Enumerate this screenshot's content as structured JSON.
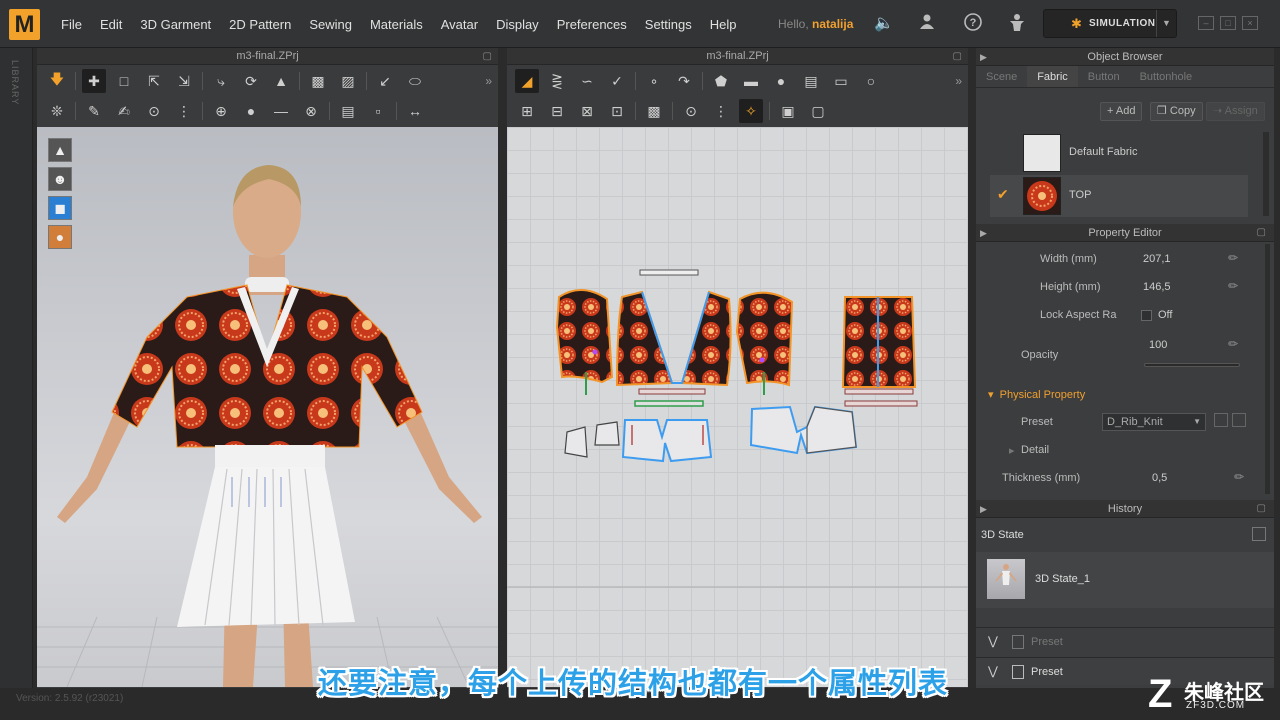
{
  "menu": {
    "logo": "M",
    "items": [
      "File",
      "Edit",
      "3D Garment",
      "2D Pattern",
      "Sewing",
      "Materials",
      "Avatar",
      "Display",
      "Preferences",
      "Settings",
      "Help"
    ],
    "hello_prefix": "Hello,",
    "user": "natalija",
    "simulation_label": "SIMULATION"
  },
  "sidebar": {
    "library_label": "LIBRARY"
  },
  "panels": {
    "view3d_title": "m3-final.ZPrj",
    "view2d_title": "m3-final.ZPrj"
  },
  "object_browser": {
    "title": "Object Browser",
    "tabs": [
      "Scene",
      "Fabric",
      "Button",
      "Buttonhole"
    ],
    "active_tab": "Fabric",
    "add_label": "+ Add",
    "copy_label": "Copy",
    "assign_label": "Assign",
    "fabrics": [
      {
        "name": "Default Fabric",
        "selected": false,
        "swatch": "#e8e8e8"
      },
      {
        "name": "TOP",
        "selected": true,
        "swatch": "#c23a10"
      }
    ]
  },
  "property_editor": {
    "title": "Property Editor",
    "width_label": "Width (mm)",
    "width_value": "207,1",
    "height_label": "Height (mm)",
    "height_value": "146,5",
    "lock_label": "Lock Aspect Ra",
    "lock_value": "Off",
    "opacity_label": "Opacity",
    "opacity_value": "100",
    "physical_label": "Physical Property",
    "preset_label": "Preset",
    "preset_value": "D_Rib_Knit",
    "detail_label": "Detail",
    "thickness_label": "Thickness (mm)",
    "thickness_value": "0,5"
  },
  "history": {
    "title": "History",
    "state_label": "3D State",
    "item_label": "3D State_1",
    "preset1": "Preset",
    "preset2": "Preset"
  },
  "status": {
    "version": "Version: 2.5.92     (r23021)"
  },
  "subtitle": "还要注意，每个上传的结构也都有一个属性列表",
  "watermark": {
    "logo": "Z",
    "cn": "朱峰社区",
    "en": "ZF3D.COM"
  },
  "colors": {
    "accent": "#f2a22b",
    "fabric_print": "#c23a10",
    "pattern_outline_selected": "#f29428",
    "pattern_outline_blue": "#3e9cf0"
  },
  "icons": [
    "volume-icon",
    "user-icon",
    "help-icon",
    "avatar-icon",
    "simulation-icon"
  ]
}
